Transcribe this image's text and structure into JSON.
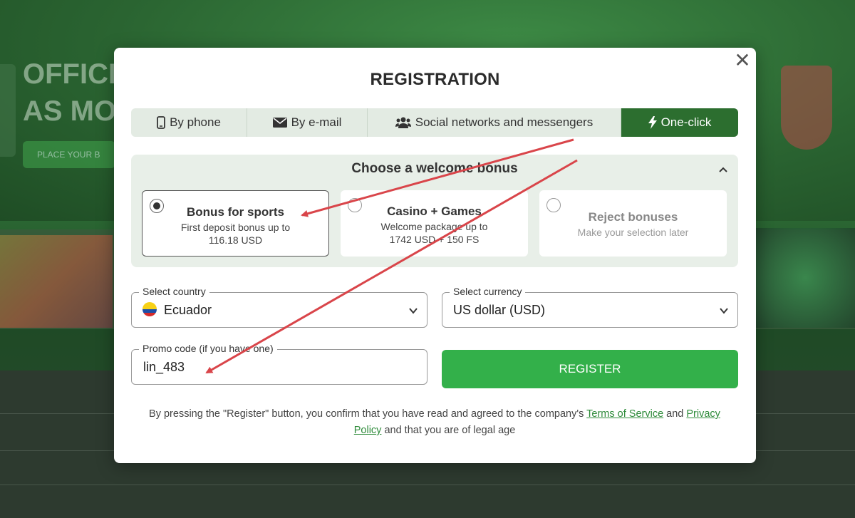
{
  "background": {
    "hero_lines": [
      "OFFICI",
      "AS MO"
    ],
    "place_label": "PLACE YOUR B"
  },
  "modal": {
    "title": "REGISTRATION",
    "close_label": "✕"
  },
  "tabs": [
    {
      "label": "By phone",
      "icon": "phone-icon",
      "active": false
    },
    {
      "label": "By e-mail",
      "icon": "envelope-icon",
      "active": false
    },
    {
      "label": "Social networks and messengers",
      "icon": "users-icon",
      "active": false
    },
    {
      "label": "One-click",
      "icon": "lightning-icon",
      "active": true
    }
  ],
  "bonus": {
    "heading": "Choose a welcome bonus",
    "options": [
      {
        "title": "Bonus for sports",
        "desc": "First deposit bonus up to 116.18 USD",
        "selected": true
      },
      {
        "title": "Casino + Games",
        "desc": "Welcome package up to 1742 USD + 150 FS",
        "selected": false
      },
      {
        "title": "Reject bonuses",
        "desc": "Make your selection later",
        "selected": false
      }
    ]
  },
  "form": {
    "country": {
      "label": "Select country",
      "value": "Ecuador"
    },
    "currency": {
      "label": "Select currency",
      "value": "US dollar (USD)"
    },
    "promo": {
      "label": "Promo code (if you have one)",
      "value": "lin_483"
    },
    "register_label": "REGISTER"
  },
  "terms": {
    "prefix": "By pressing the \"Register\" button, you confirm that you have read and agreed to the company's ",
    "tos_link": "Terms of Service",
    "and": " and ",
    "privacy_link": "Privacy Policy",
    "suffix": " and that you are of legal age"
  },
  "colors": {
    "accent_green": "#33b04a",
    "tab_active": "#2c6e2f",
    "annotation_arrow": "#d9454a"
  }
}
